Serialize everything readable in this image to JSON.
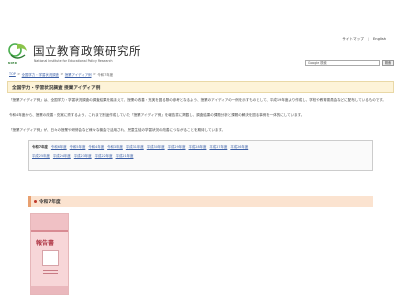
{
  "header": {
    "links": [
      "サイトマップ",
      "English"
    ],
    "logo_text": "NIER",
    "site_title": "国立教育政策研究所",
    "site_subtitle": "National Institute for Educational Policy Research",
    "search_placeholder": "Google 検索",
    "search_button": "検索"
  },
  "breadcrumb": [
    "TOP",
    "全国学力・学習状況調査",
    "授業アイディア例",
    "令和7年度"
  ],
  "page_title": "全国学力・学習状況調査 授業アイディア例",
  "paragraphs": [
    "「授業アイディア例」は、全国学力・学習状況調査の調査結果を踏まえて、授業の改善・充実を図る際の参考となるよう、授業のアイディアの一例を示すものとして、平成19年度より作成し、学校や教育委員会などに配布しているものです。",
    "令和4年度から、授業の改善・充実に資するよう、これまで別途作成していた「授業アイディア例」を報告書に掲載し、調査結果の課題分析と課題の解決を図る事例を一体的にしています。",
    "「授業アイディア例」が、日々の授業や研修会など様々な機会で活用され、児童生徒の学習状況の改善につながることを期待しています。"
  ],
  "year_nav": {
    "lead": "令和7年度",
    "rows": [
      [
        "令和6年度",
        "令和5年度",
        "令和4年度",
        "令和3年度",
        "平成31年度",
        "平成30年度",
        "平成29年度",
        "平成28年度",
        "平成27年度",
        "平成26年度"
      ],
      [
        "平成25年度",
        "平成24年度",
        "平成23年度",
        "平成22年度",
        "平成21年度"
      ]
    ]
  },
  "section_heading": "令和7年度",
  "book": {
    "label": "報告書"
  }
}
